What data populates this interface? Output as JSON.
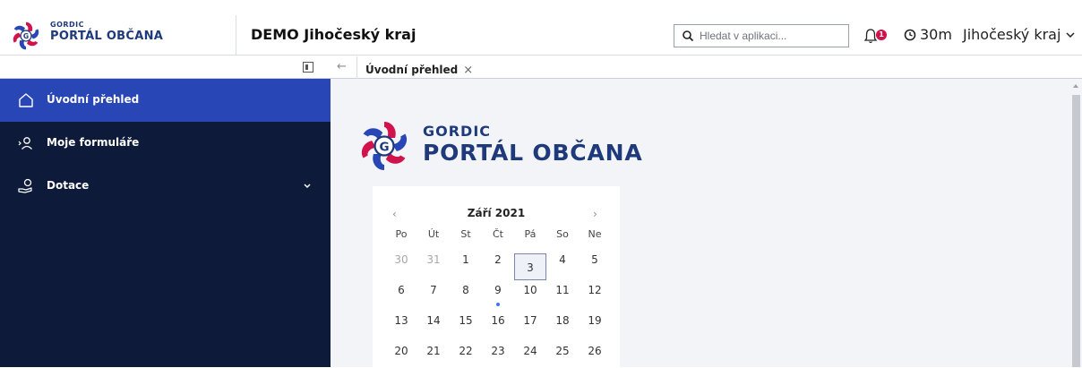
{
  "brand": {
    "small_top": "GORDIC",
    "small_bottom": "PORTÁL OBČANA",
    "big_top": "GORDIC",
    "big_bottom": "PORTÁL OBČANA"
  },
  "header": {
    "app_title": "DEMO Jihočeský kraj",
    "search_placeholder": "Hledat v aplikaci...",
    "notification_count": "1",
    "timer": "30m",
    "region": "Jihočeský kraj"
  },
  "tabs": {
    "active_label": "Úvodní přehled",
    "back_symbol": "←",
    "close_symbol": "×"
  },
  "sidebar": {
    "items": [
      {
        "label": "Úvodní přehled",
        "icon": "home-icon",
        "active": true
      },
      {
        "label": "Moje formuláře",
        "icon": "user-forms-icon",
        "active": false
      },
      {
        "label": "Dotace",
        "icon": "hand-coin-icon",
        "active": false,
        "expandable": true
      }
    ]
  },
  "calendar": {
    "title": "Září 2021",
    "prev": "‹",
    "next": "›",
    "weekdays": [
      "Po",
      "Út",
      "St",
      "Čt",
      "Pá",
      "So",
      "Ne"
    ],
    "weeks": [
      [
        "30",
        "31",
        "1",
        "2",
        "3",
        "4",
        "5"
      ],
      [
        "6",
        "7",
        "8",
        "9",
        "10",
        "11",
        "12"
      ],
      [
        "13",
        "14",
        "15",
        "16",
        "17",
        "18",
        "19"
      ],
      [
        "20",
        "21",
        "22",
        "23",
        "24",
        "25",
        "26"
      ]
    ],
    "muted_days": [
      "30",
      "31"
    ],
    "today": "3",
    "event_days": [
      "9"
    ]
  },
  "colors": {
    "sidebar_bg": "#0d1a3a",
    "active_item": "#2946b7",
    "brand_blue": "#1f3a7a",
    "badge_red": "#d1124b"
  }
}
